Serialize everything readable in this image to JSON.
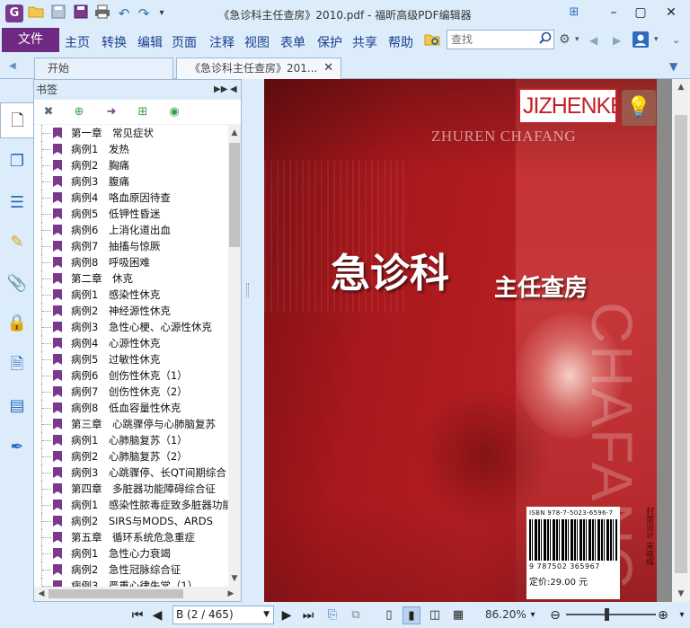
{
  "window": {
    "title": "《急诊科主任查房》2010.pdf - 福昕高级PDF编辑器",
    "app_logo": "G"
  },
  "quick_access": [
    "open-folder-icon",
    "save-icon",
    "save-as-icon",
    "print-icon",
    "undo-icon",
    "redo-icon",
    "customize-icon"
  ],
  "menu": {
    "file": "文件",
    "items": [
      "主页",
      "转换",
      "编辑",
      "页面",
      "注释",
      "视图",
      "表单",
      "保护",
      "共享",
      "帮助"
    ],
    "search_placeholder": "查找"
  },
  "tabs": {
    "start": "开始",
    "document": "《急诊科主任查房》201..."
  },
  "bookmarks": {
    "header": "书签",
    "items": [
      "第一章　常见症状",
      "病例1　发热",
      "病例2　胸痛",
      "病例3　腹痛",
      "病例4　咯血原因待查",
      "病例5　低钾性昏迷",
      "病例6　上消化道出血",
      "病例7　抽搐与惊厥",
      "病例8　呼吸困难",
      "第二章　休克",
      "病例1　感染性休克",
      "病例2　神经源性休克",
      "病例3　急性心梗、心源性休克",
      "病例4　心源性休克",
      "病例5　过敏性休克",
      "病例6　创伤性休克（1）",
      "病例7　创伤性休克（2）",
      "病例8　低血容量性休克",
      "第三章　心跳骤停与心肺脑复苏",
      "病例1　心肺脑复苏（1）",
      "病例2　心肺脑复苏（2）",
      "病例3　心跳骤停、长QT间期综合",
      "第四章　多脏器功能障碍综合征",
      "病例1　感染性脓毒症致多脏器功能",
      "病例2　SIRS与MODS、ARDS",
      "第五章　循环系统危急重症",
      "病例1　急性心力衰竭",
      "病例2　急性冠脉综合征",
      "病例3　严重心律失常（1）"
    ]
  },
  "cover": {
    "brand": "JIZHENKE",
    "subtitle": "ZHUREN CHAFANG",
    "title_main": "急诊科",
    "title_sub": "主任查房",
    "vertical": "CHAFANG",
    "isbn_top": "ISBN 978-7-5023-6596-7",
    "isbn_bottom": "9 787502 365967",
    "price": "定价:29.00 元",
    "stamp": "封面设计 宋晓辉"
  },
  "status": {
    "page": "B (2 / 465)",
    "zoom": "86.20%"
  }
}
